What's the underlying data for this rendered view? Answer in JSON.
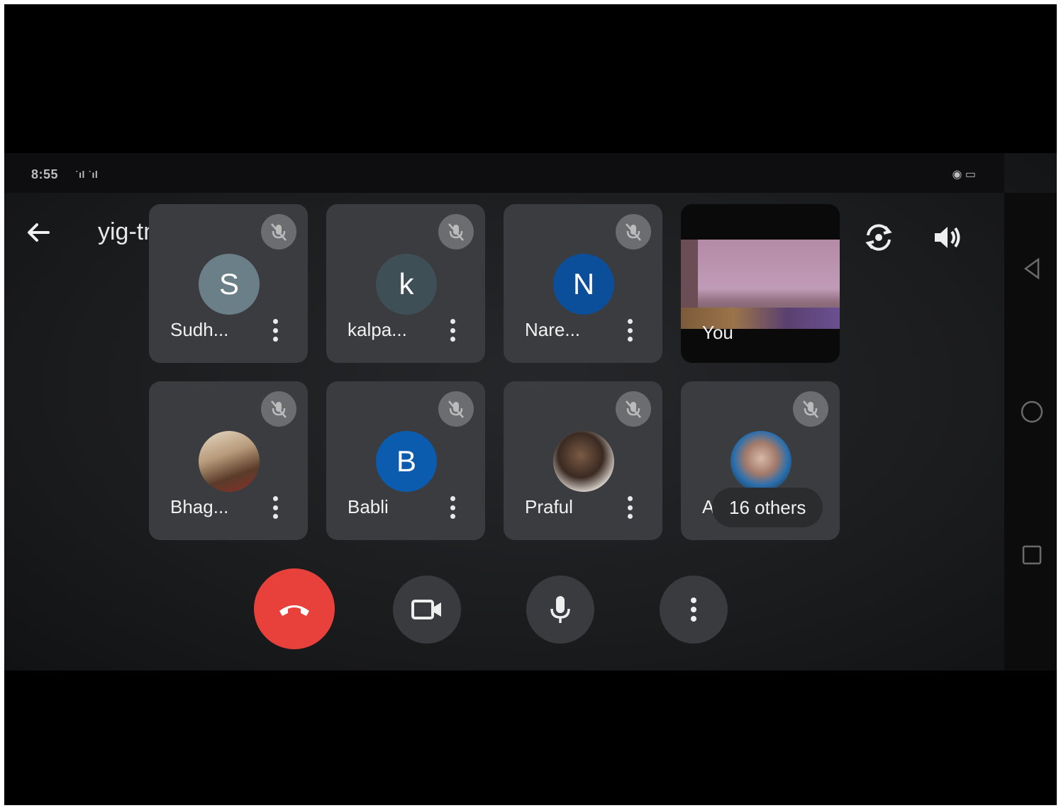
{
  "status": {
    "time": "8:55",
    "signal": "˙ıl ˙ıl",
    "battery": "◉ ▭"
  },
  "header": {
    "meeting_code": "yig-tmdq-dbg",
    "chevron": "›"
  },
  "participants": [
    {
      "name": "Sudh...",
      "initial": "S",
      "avatar_color": "#6b7f88",
      "avatar_type": "initial"
    },
    {
      "name": "kalpa...",
      "initial": "k",
      "avatar_color": "#3f4f56",
      "avatar_type": "initial"
    },
    {
      "name": "Nare...",
      "initial": "N",
      "avatar_color": "#0b4f9a",
      "avatar_type": "initial"
    },
    {
      "name": "You",
      "avatar_type": "video"
    },
    {
      "name": "Bhag...",
      "avatar_type": "photo"
    },
    {
      "name": "Babli",
      "initial": "B",
      "avatar_color": "#0b5cae",
      "avatar_type": "initial"
    },
    {
      "name": "Praful",
      "avatar_type": "photo"
    },
    {
      "name": "A",
      "avatar_type": "photo",
      "others_label": "16 others"
    }
  ],
  "controls": {
    "end_call_color": "#e8413b",
    "button_color": "#3a3b3e"
  },
  "icons": {
    "back": "arrow-back-icon",
    "switch_camera": "switch-camera-icon",
    "speaker": "speaker-icon",
    "mic_off": "mic-off-icon",
    "end_call": "phone-hangup-icon",
    "camera": "video-camera-icon",
    "mic": "microphone-icon",
    "more": "more-vertical-icon"
  }
}
